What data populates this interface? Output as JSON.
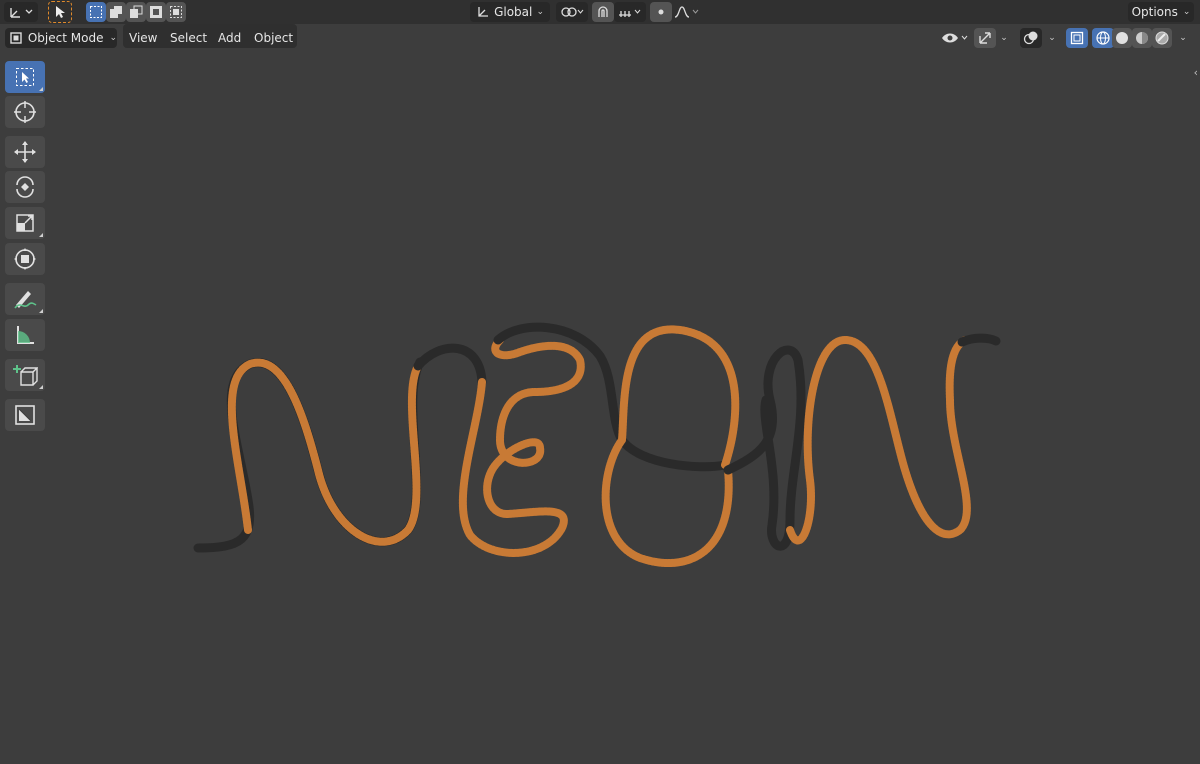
{
  "header": {
    "transform_orientation": "Global",
    "options_label": "Options"
  },
  "viewport_header": {
    "mode_label": "Object Mode",
    "menus": [
      "View",
      "Select",
      "Add",
      "Object"
    ]
  },
  "toolbar": {
    "tools": [
      {
        "icon": "select-box-icon",
        "active": true
      },
      {
        "icon": "cursor-icon"
      },
      {
        "icon": "move-icon"
      },
      {
        "icon": "rotate-icon"
      },
      {
        "icon": "scale-icon"
      },
      {
        "icon": "transform-icon"
      },
      {
        "icon": "annotate-icon"
      },
      {
        "icon": "measure-icon"
      },
      {
        "icon": "add-cube-icon"
      },
      {
        "icon": "shade-icon"
      }
    ]
  },
  "scene": {
    "object_word": "NEON",
    "selected_color": "#c87a35",
    "unselected_color": "#2a2a2a",
    "background_color": "#3d3d3d"
  },
  "colors": {
    "accent": "#4772b3",
    "header_bg": "#303030",
    "dropdown_bg": "#282828"
  }
}
